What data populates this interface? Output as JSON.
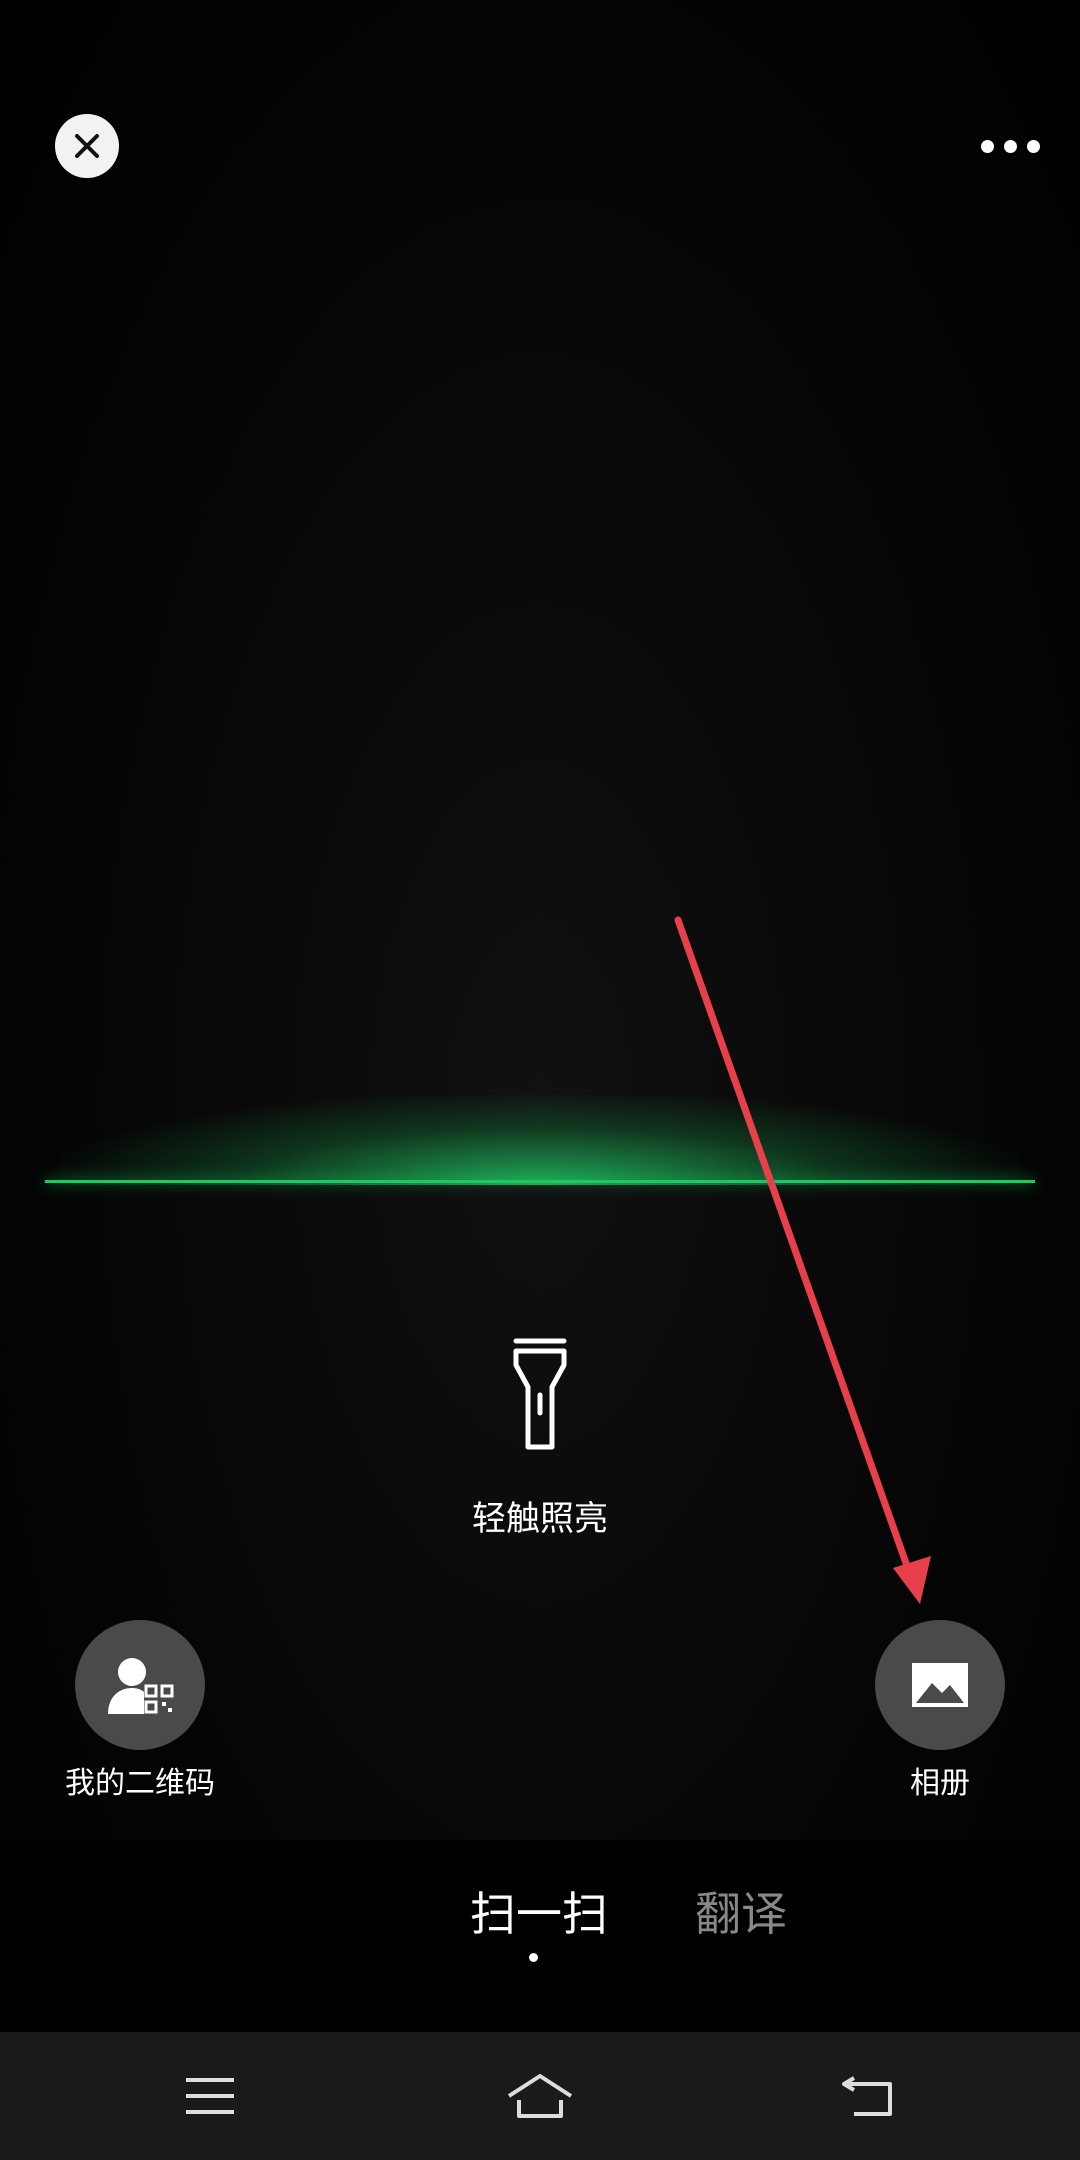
{
  "scanner": {
    "torch_label": "轻触照亮",
    "my_qr_label": "我的二维码",
    "album_label": "相册"
  },
  "modes": {
    "active": "扫一扫",
    "inactive": "翻译"
  },
  "icons": {
    "close": "close-icon",
    "more": "more-icon",
    "torch": "flashlight-icon",
    "my_qr": "person-qr-icon",
    "album": "image-icon",
    "nav_menu": "menu-icon",
    "nav_home": "home-icon",
    "nav_back": "back-icon"
  },
  "colors": {
    "scan_line": "#1ec864",
    "annotation_arrow": "#e8404a",
    "button_bg": "#4a4a4a"
  }
}
